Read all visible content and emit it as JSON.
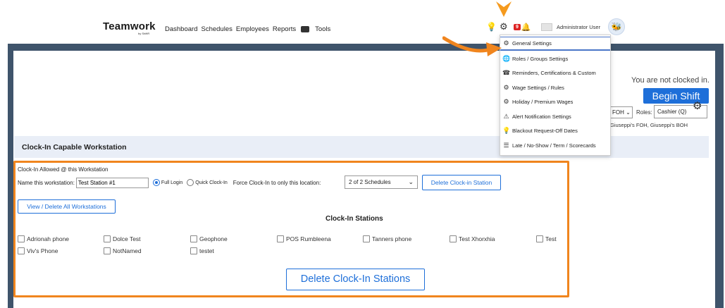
{
  "header": {
    "logo": "Teamwork",
    "logo_sub": "by ShiftR",
    "nav": [
      "Dashboard",
      "Schedules",
      "Employees",
      "Reports",
      "Tools"
    ],
    "notification_count": "9",
    "user_name": "Administrator User"
  },
  "dropdown": {
    "items": [
      {
        "icon": "gear-icon",
        "label": "General Settings",
        "active": true
      },
      {
        "icon": "globe-icon",
        "label": "Roles / Groups Settings"
      },
      {
        "icon": "bell-icon",
        "label": "Reminders, Certifications & Custom"
      },
      {
        "icon": "wage-icon",
        "label": "Wage Settings / Rules"
      },
      {
        "icon": "wage-icon",
        "label": "Holiday / Premium Wages"
      },
      {
        "icon": "warning-icon",
        "label": "Alert Notification Settings"
      },
      {
        "icon": "bulb-icon",
        "label": "Blackout Request-Off Dates"
      },
      {
        "icon": "scorecard-icon",
        "label": "Late / No-Show / Term / Scorecards"
      }
    ]
  },
  "clockin": {
    "status": "You are not clocked in.",
    "begin_shift": "Begin Shift",
    "location_value": "FOH",
    "roles_label": "Roles:",
    "roles_value": "Cashier (Q)",
    "roles_sub": "Giuseppi's FOH, Giuseppi's BOH"
  },
  "section": {
    "title": "Clock-In Capable Workstation"
  },
  "workstation": {
    "allowed_title": "Clock-In Allowed @ this Workstation",
    "name_label": "Name this workstation:",
    "name_value": "Test Station #1",
    "full_login": "Full Login",
    "quick_clockin": "Quick Clock-In",
    "force_label": "Force Clock-In to only this location:",
    "schedule_select": "2 of 2 Schedules",
    "delete_station_btn": "Delete Clock-in Station",
    "view_all_btn": "View / Delete All Workstations",
    "stations_title": "Clock-In Stations",
    "stations": [
      "Adrionah phone",
      "Dolce Test",
      "Geophone",
      "POS Rumbleena",
      "Tanners phone",
      "Test Xhorxhia",
      "Test",
      "Viv's Phone",
      "NotNamed",
      "testet"
    ],
    "delete_all_btn": "Delete Clock-In Stations"
  },
  "colors": {
    "accent": "#1e6fd9",
    "highlight": "#f0851e",
    "frame": "#3f546b"
  }
}
